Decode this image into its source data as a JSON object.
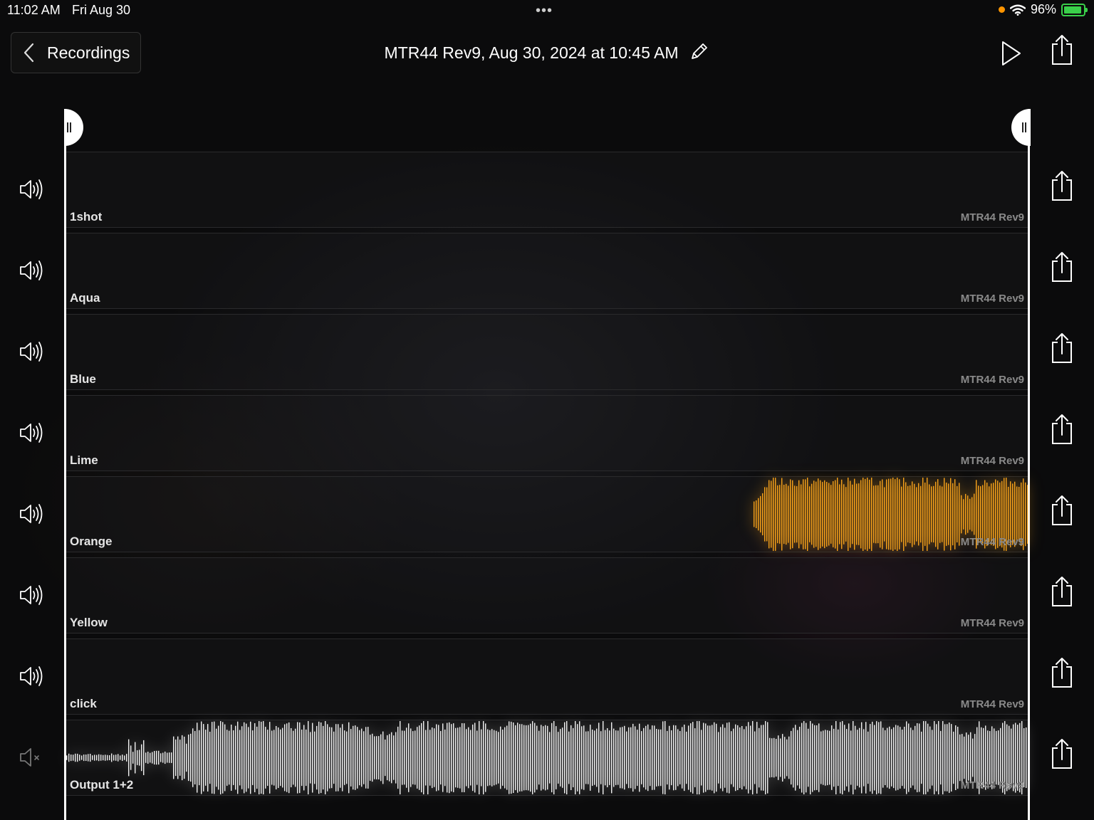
{
  "status_bar": {
    "time": "11:02 AM",
    "date": "Fri Aug 30",
    "dots": "•••",
    "battery_percent": "96%",
    "battery_level": 0.96,
    "charging": true,
    "wifi_icon": "wifi-icon",
    "privacy_indicator_color": "#ff9500"
  },
  "header": {
    "back_label": "Recordings",
    "title": "MTR44 Rev9, Aug 30, 2024 at 10:45 AM",
    "icons": [
      "chevron-left-icon",
      "pencil-icon",
      "play-icon",
      "share-icon"
    ]
  },
  "tracks": [
    {
      "name": "1shot",
      "source": "MTR44 Rev9",
      "muted": false,
      "has_audio": false
    },
    {
      "name": "Aqua",
      "source": "MTR44 Rev9",
      "muted": false,
      "has_audio": false
    },
    {
      "name": "Blue",
      "source": "MTR44 Rev9",
      "muted": false,
      "has_audio": false
    },
    {
      "name": "Lime",
      "source": "MTR44 Rev9",
      "muted": false,
      "has_audio": false
    },
    {
      "name": "Orange",
      "source": "MTR44 Rev9",
      "muted": false,
      "has_audio": true,
      "wave_color": "#f7a21b",
      "audio_start_fraction": 0.715
    },
    {
      "name": "Yellow",
      "source": "MTR44 Rev9",
      "muted": false,
      "has_audio": false
    },
    {
      "name": "click",
      "source": "MTR44 Rev9",
      "muted": false,
      "has_audio": false
    },
    {
      "name": "Output 1+2",
      "source": "MTR44 Rev9",
      "muted": true,
      "has_audio": true,
      "wave_color": "#f2f2f2",
      "audio_start_fraction": 0.0
    }
  ],
  "colors": {
    "background": "#0b0b0c",
    "frame": "#ffffff",
    "accent_orange": "#f7a21b"
  }
}
